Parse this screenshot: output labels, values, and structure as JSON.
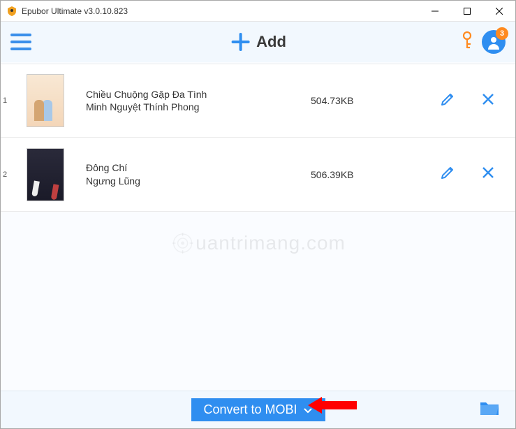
{
  "window": {
    "title": "Epubor Ultimate v3.0.10.823"
  },
  "toolbar": {
    "add_label": "Add",
    "notification_count": "3"
  },
  "books": [
    {
      "index": "1",
      "title": "Chiều Chuộng Gặp Đa Tình",
      "author": "Minh Nguyệt Thính Phong",
      "size": "504.73KB"
    },
    {
      "index": "2",
      "title": "Đông Chí",
      "author": "Ngưng Lũng",
      "size": "506.39KB"
    }
  ],
  "footer": {
    "convert_label": "Convert to MOBI"
  },
  "watermark": "uantrimang.com"
}
